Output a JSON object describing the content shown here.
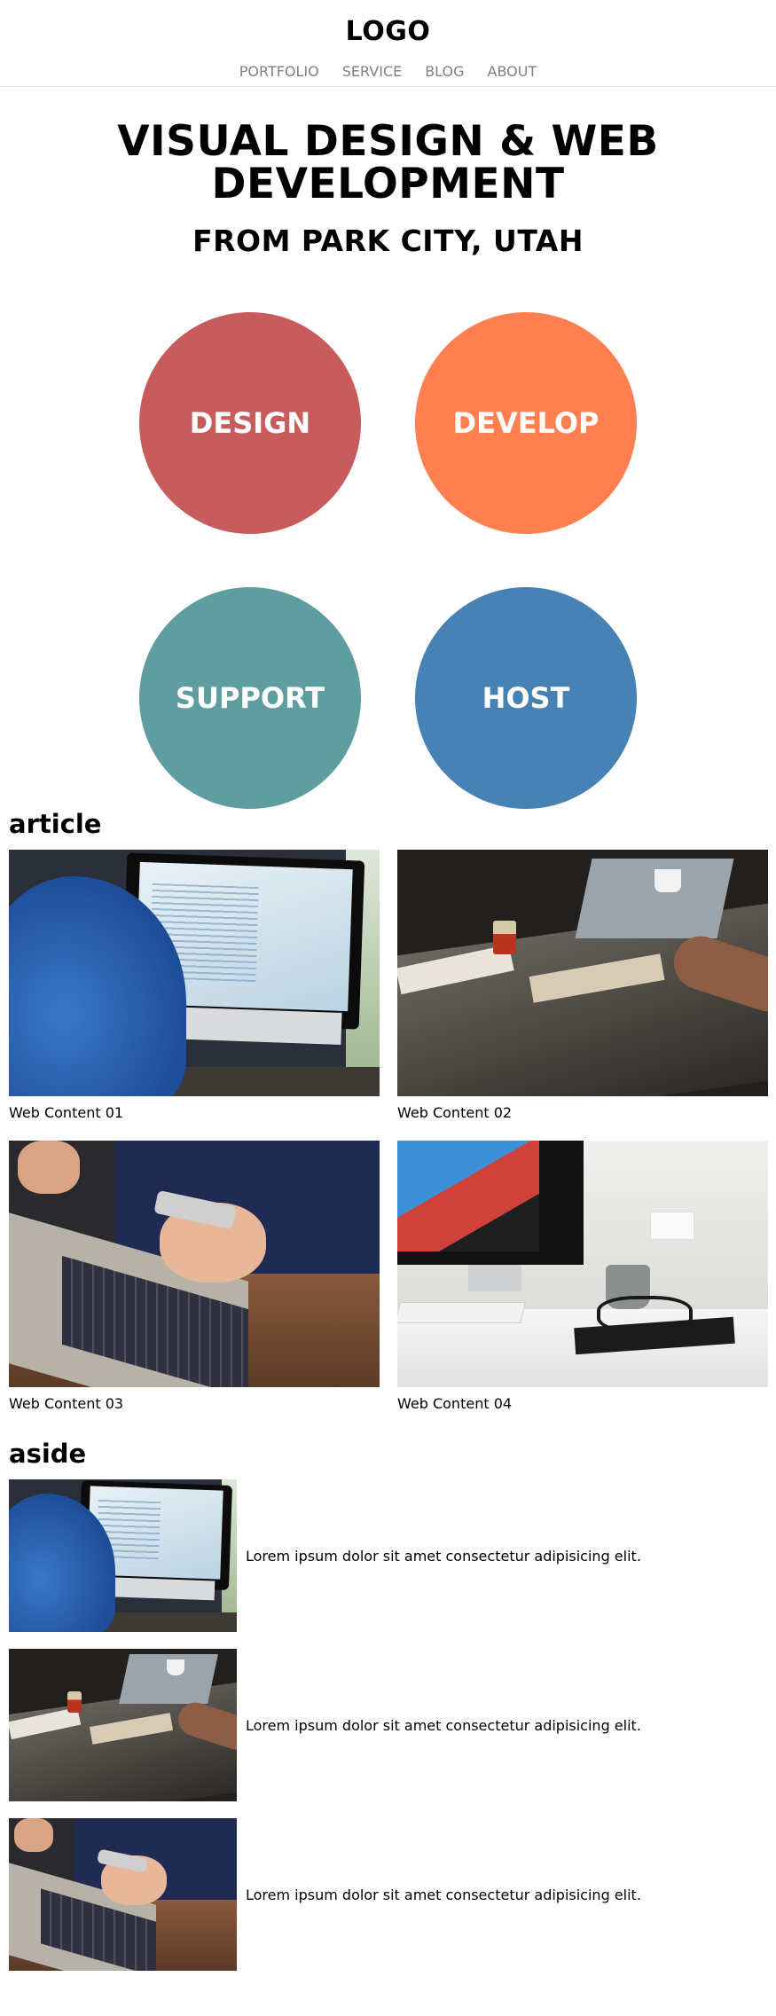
{
  "header": {
    "logo": "LOGO",
    "nav": [
      {
        "label": "PORTFOLIO"
      },
      {
        "label": "SERVICE"
      },
      {
        "label": "BLOG"
      },
      {
        "label": "ABOUT"
      }
    ]
  },
  "hero": {
    "title_line1": "VISUAL DESIGN & WEB",
    "title_line2": "DEVELOPMENT",
    "subtitle": "FROM PARK CITY, UTAH"
  },
  "services": [
    {
      "label": "DESIGN",
      "color": "#C85C5C"
    },
    {
      "label": "DEVELOP",
      "color": "#FF7F50"
    },
    {
      "label": "SUPPORT",
      "color": "#5F9EA0"
    },
    {
      "label": "HOST",
      "color": "#4682B4"
    }
  ],
  "article": {
    "title": "article",
    "items": [
      {
        "caption": "Web Content 01",
        "image": "imac-coding-photo"
      },
      {
        "caption": "Web Content 02",
        "image": "team-meeting-table-photo"
      },
      {
        "caption": "Web Content 03",
        "image": "phone-and-laptop-photo"
      },
      {
        "caption": "Web Content 04",
        "image": "imac-workspace-photo"
      }
    ]
  },
  "aside": {
    "title": "aside",
    "items": [
      {
        "text": "Lorem ipsum dolor sit amet consectetur adipisicing elit.",
        "image": "imac-coding-photo"
      },
      {
        "text": "Lorem ipsum dolor sit amet consectetur adipisicing elit.",
        "image": "team-meeting-table-photo"
      },
      {
        "text": "Lorem ipsum dolor sit amet consectetur adipisicing elit.",
        "image": "phone-and-laptop-photo"
      }
    ]
  }
}
